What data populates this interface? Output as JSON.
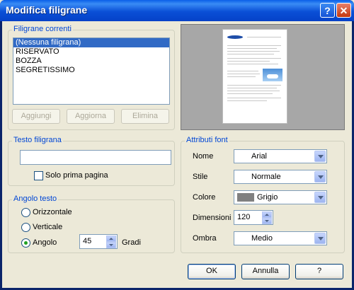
{
  "window": {
    "title": "Modifica filigrane",
    "help_glyph": "?",
    "close_glyph": "✕"
  },
  "current": {
    "title": "Filigrane correnti",
    "items": [
      "(Nessuna filigrana)",
      "RISERVATO",
      "BOZZA",
      "SEGRETISSIMO"
    ],
    "selected_index": 0,
    "buttons": {
      "add": "Aggiungi",
      "update": "Aggiorna",
      "delete": "Elimina"
    }
  },
  "watermark_text": {
    "title": "Testo filigrana",
    "value": "",
    "first_page_only_label": "Solo prima pagina",
    "first_page_only_checked": false
  },
  "angle": {
    "title": "Angolo testo",
    "horizontal": "Orizzontale",
    "vertical": "Verticale",
    "angle_label": "Angolo",
    "selected": "Angolo",
    "value": "45",
    "unit": "Gradi"
  },
  "font": {
    "title": "Attributi font",
    "name_label": "Nome",
    "name_value": "Arial",
    "style_label": "Stile",
    "style_value": "Normale",
    "color_label": "Colore",
    "color_value": "Grigio",
    "color_swatch": "#808080",
    "size_label": "Dimensioni",
    "size_value": "120",
    "shadow_label": "Ombra",
    "shadow_value": "Medio"
  },
  "buttons": {
    "ok": "OK",
    "cancel": "Annulla",
    "help": "?"
  },
  "colors": {
    "title_bar": "#0A4FD6",
    "group_title": "#0046D5",
    "selection": "#316AC5",
    "dialog_bg": "#ECE9D8"
  }
}
